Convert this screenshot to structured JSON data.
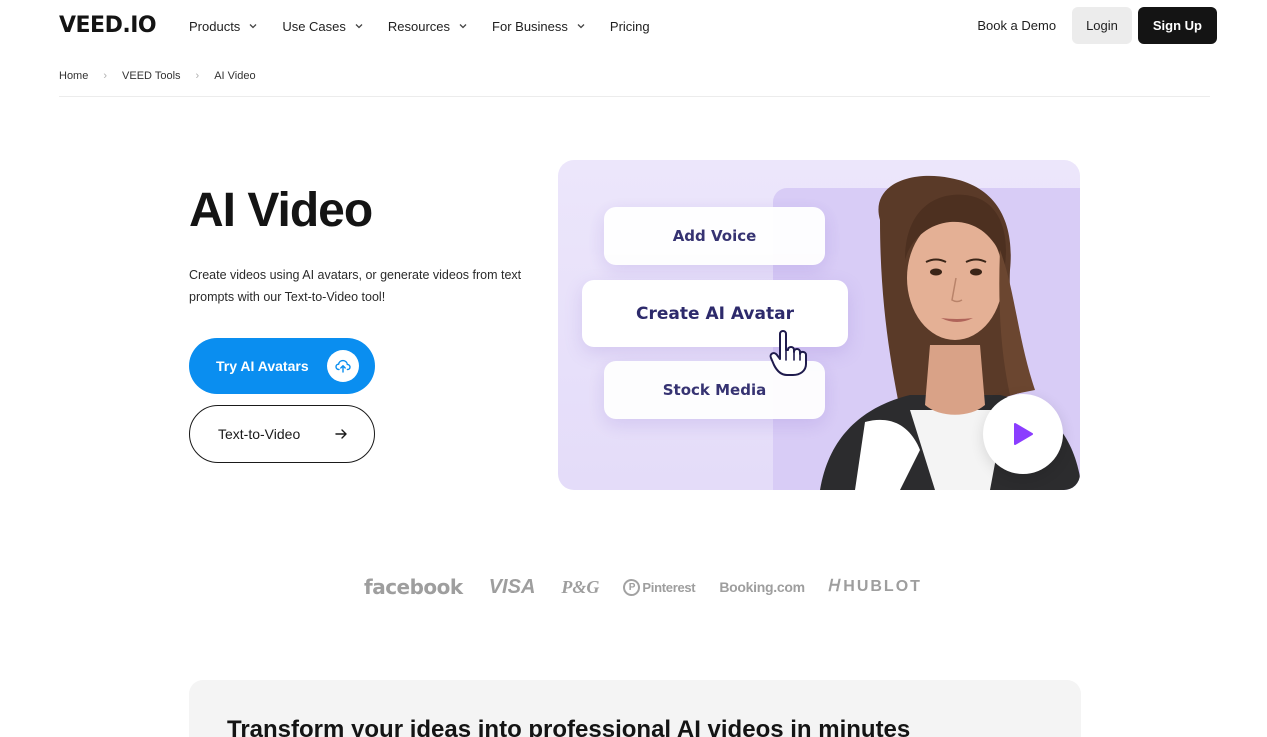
{
  "brand": {
    "logo": "VEED.IO",
    "accent": "#0a8ef0",
    "dark": "#141414"
  },
  "nav": {
    "items": [
      {
        "label": "Products",
        "has_dropdown": true
      },
      {
        "label": "Use Cases",
        "has_dropdown": true
      },
      {
        "label": "Resources",
        "has_dropdown": true
      },
      {
        "label": "For Business",
        "has_dropdown": true
      },
      {
        "label": "Pricing",
        "has_dropdown": false
      }
    ],
    "book_demo": "Book a Demo",
    "login": "Login",
    "signup": "Sign Up"
  },
  "breadcrumb": [
    "Home",
    "VEED Tools",
    "AI Video"
  ],
  "hero": {
    "title": "AI Video",
    "description": "Create videos using AI avatars, or generate videos from text prompts with our Text-to-Video tool!",
    "primary_cta": "Try AI Avatars",
    "secondary_cta": "Text-to-Video"
  },
  "visual": {
    "pills": [
      "Add Voice",
      "Create AI Avatar",
      "Stock Media"
    ],
    "icons": [
      "hand-pointer-icon",
      "play-icon"
    ]
  },
  "logos": [
    "facebook",
    "VISA",
    "P&G",
    "Pinterest",
    "Booking.com",
    "HUBLOT"
  ],
  "bottom_section": {
    "title": "Transform your ideas into professional AI videos in minutes"
  }
}
